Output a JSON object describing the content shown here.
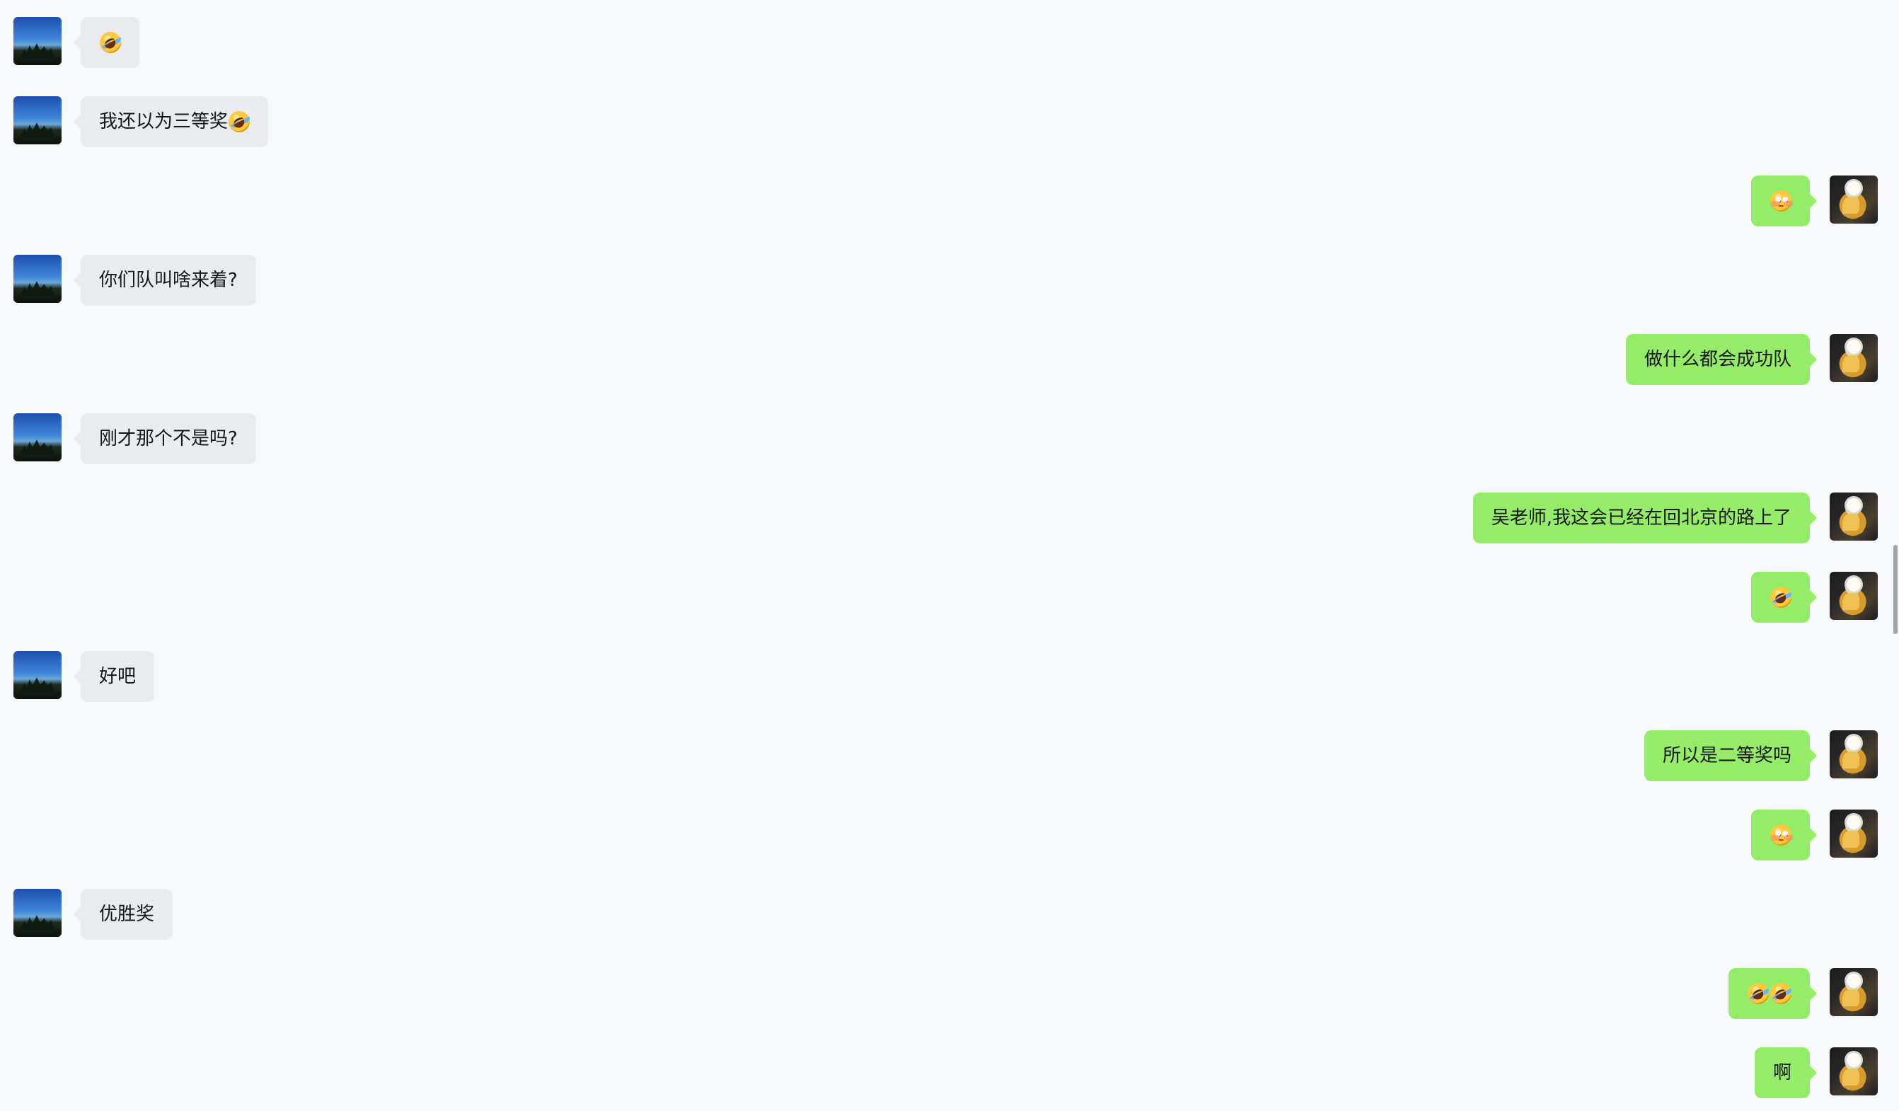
{
  "chat": {
    "messages": [
      {
        "direction": "in",
        "text": "",
        "emojis": [
          "rofl"
        ]
      },
      {
        "direction": "in",
        "text": "我还以为三等奖",
        "emojis": [
          "rofl"
        ]
      },
      {
        "direction": "out",
        "text": "",
        "emojis": [
          "flushed"
        ]
      },
      {
        "direction": "in",
        "text": "你们队叫啥来着?",
        "emojis": []
      },
      {
        "direction": "out",
        "text": "做什么都会成功队",
        "emojis": []
      },
      {
        "direction": "in",
        "text": "刚才那个不是吗?",
        "emojis": []
      },
      {
        "direction": "out",
        "text": "吴老师,我这会已经在回北京的路上了",
        "emojis": []
      },
      {
        "direction": "out",
        "text": "",
        "emojis": [
          "rofl"
        ]
      },
      {
        "direction": "in",
        "text": "好吧",
        "emojis": []
      },
      {
        "direction": "out",
        "text": "所以是二等奖吗",
        "emojis": []
      },
      {
        "direction": "out",
        "text": "",
        "emojis": [
          "flushed"
        ]
      },
      {
        "direction": "in",
        "text": "优胜奖",
        "emojis": []
      },
      {
        "direction": "out",
        "text": "",
        "emojis": [
          "rofl",
          "rofl"
        ]
      },
      {
        "direction": "out",
        "text": "啊",
        "emojis": []
      }
    ]
  },
  "colors": {
    "background": "#f7f8f9",
    "incoming_bubble": "#e9ebee",
    "outgoing_bubble": "#95ec69",
    "text": "#171717",
    "scrollbar": "#9fa4a8"
  },
  "icons": {
    "rofl": "rolling-on-the-floor-laughing-emoji",
    "flushed": "flushed-emoji"
  }
}
